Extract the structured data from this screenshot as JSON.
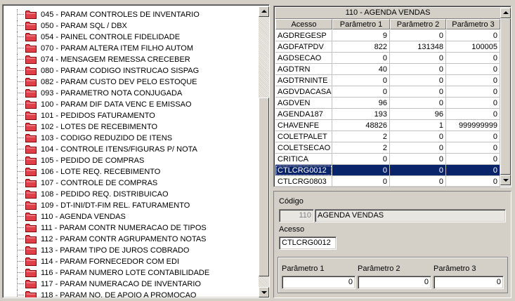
{
  "tree": {
    "items": [
      "045 - PARAM CONTROLES DE INVENTARIO",
      "050 - PARAM SQL / DBX",
      "054 - PAINEL CONTROLE FIDELIDADE",
      "070 - PARAM ALTERA ITEM FILHO AUTOM",
      "074 - MENSAGEM REMESSA CRECEBER",
      "080 - PARAM CODIGO INSTRUCAO SISPAG",
      "082 - PARAM CUSTO DEV PELO ESTOQUE",
      "093 - PARAMETRO NOTA CONJUGADA",
      "100 - PARAM DIF DATA VENC E EMISSAO",
      "101 - PEDIDOS FATURAMENTO",
      "102 - LOTES DE RECEBIMENTO",
      "103 - CODIGO REDUZIDO DE ITENS",
      "104 - CONTROLE ITENS/FIGURAS P/ NOTA",
      "105 - PEDIDO DE COMPRAS",
      "106 - LOTE REQ. RECEBIMENTO",
      "107 - CONTROLE DE COMPRAS",
      "108 - PEDIDO REQ. DISTRIBUICAO",
      "109 - DT-INI/DT-FIM REL. FATURAMENTO",
      "110 - AGENDA VENDAS",
      "111 - PARAM CONTR NUMERACAO DE TIPOS",
      "112 - PARAM CONTR AGRUPAMENTO NOTAS",
      "113 - PARAM TIPO DE JUROS COBRADO",
      "114 - PARAM FORNECEDOR COM EDI",
      "116 - PARAM NUMERO LOTE CONTABILIDADE",
      "117 - PARAM NUMERACAO DE INVENTARIO",
      "118 - PARAM NO. DE APOIO A PROMOCAO"
    ]
  },
  "grid": {
    "title": "110 - AGENDA VENDAS",
    "headers": [
      "Acesso",
      "Parâmetro 1",
      "Parâmetro 2",
      "Parâmetro 3"
    ],
    "rows": [
      [
        "AGDREGESP",
        "9",
        "0",
        "0"
      ],
      [
        "AGDFATPDV",
        "822",
        "131348",
        "100005"
      ],
      [
        "AGDSECAO",
        "0",
        "0",
        "0"
      ],
      [
        "AGDTRN",
        "40",
        "0",
        "0"
      ],
      [
        "AGDTRNINTE",
        "0",
        "0",
        "0"
      ],
      [
        "AGDVDACASA",
        "0",
        "0",
        "0"
      ],
      [
        "AGDVEN",
        "96",
        "0",
        "0"
      ],
      [
        "AGENDA187",
        "193",
        "96",
        "0"
      ],
      [
        "CHAVENFE",
        "48826",
        "1",
        "999999999"
      ],
      [
        "COLETPALET",
        "2",
        "0",
        "0"
      ],
      [
        "COLETSECAO",
        "2",
        "0",
        "0"
      ],
      [
        "CRITICA",
        "0",
        "0",
        "0"
      ],
      [
        "CTLCRG0012",
        "0",
        "0",
        "0"
      ],
      [
        "CTLCRG0803",
        "0",
        "0",
        "0"
      ]
    ],
    "selected_row": 12
  },
  "detail": {
    "codigo_label": "Código",
    "codigo_value": "110",
    "codigo_desc": "AGENDA VENDAS",
    "acesso_label": "Acesso",
    "acesso_value": "CTLCRG0012",
    "p1_label": "Parâmetro 1",
    "p1_value": "0",
    "p2_label": "Parâmetro 2",
    "p2_value": "0",
    "p3_label": "Parâmetro 3",
    "p3_value": "0"
  },
  "colors": {
    "selection": "#0a246a",
    "folder": "#e0404a",
    "face": "#d4d0c8"
  }
}
